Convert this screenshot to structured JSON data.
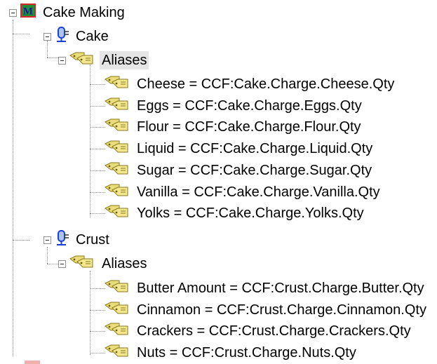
{
  "tree": {
    "root": {
      "label": "Cake Making",
      "icon": "recipe-m-icon",
      "expanded": true,
      "children": [
        {
          "label": "Cake",
          "icon": "unit-tank-icon",
          "expanded": true,
          "aliases_label": "Aliases",
          "aliases_icon": "tag-icon",
          "aliases_selected": true,
          "aliases": [
            "Cheese = CCF:Cake.Charge.Cheese.Qty",
            "Eggs = CCF:Cake.Charge.Eggs.Qty",
            "Flour = CCF:Cake.Charge.Flour.Qty",
            "Liquid = CCF:Cake.Charge.Liquid.Qty",
            "Sugar = CCF:Cake.Charge.Sugar.Qty",
            "Vanilla = CCF:Cake.Charge.Vanilla.Qty",
            "Yolks = CCF:Cake.Charge.Yolks.Qty"
          ]
        },
        {
          "label": "Crust",
          "icon": "unit-tank-icon",
          "expanded": true,
          "aliases_label": "Aliases",
          "aliases_icon": "tag-icon",
          "aliases_selected": false,
          "aliases": [
            "Butter Amount = CCF:Crust.Charge.Butter.Qty",
            "Cinnamon = CCF:Crust.Charge.Cinnamon.Qty",
            "Crackers = CCF:Crust.Charge.Crackers.Qty",
            "Nuts = CCF:Crust.Charge.Nuts.Qty"
          ]
        }
      ]
    }
  }
}
